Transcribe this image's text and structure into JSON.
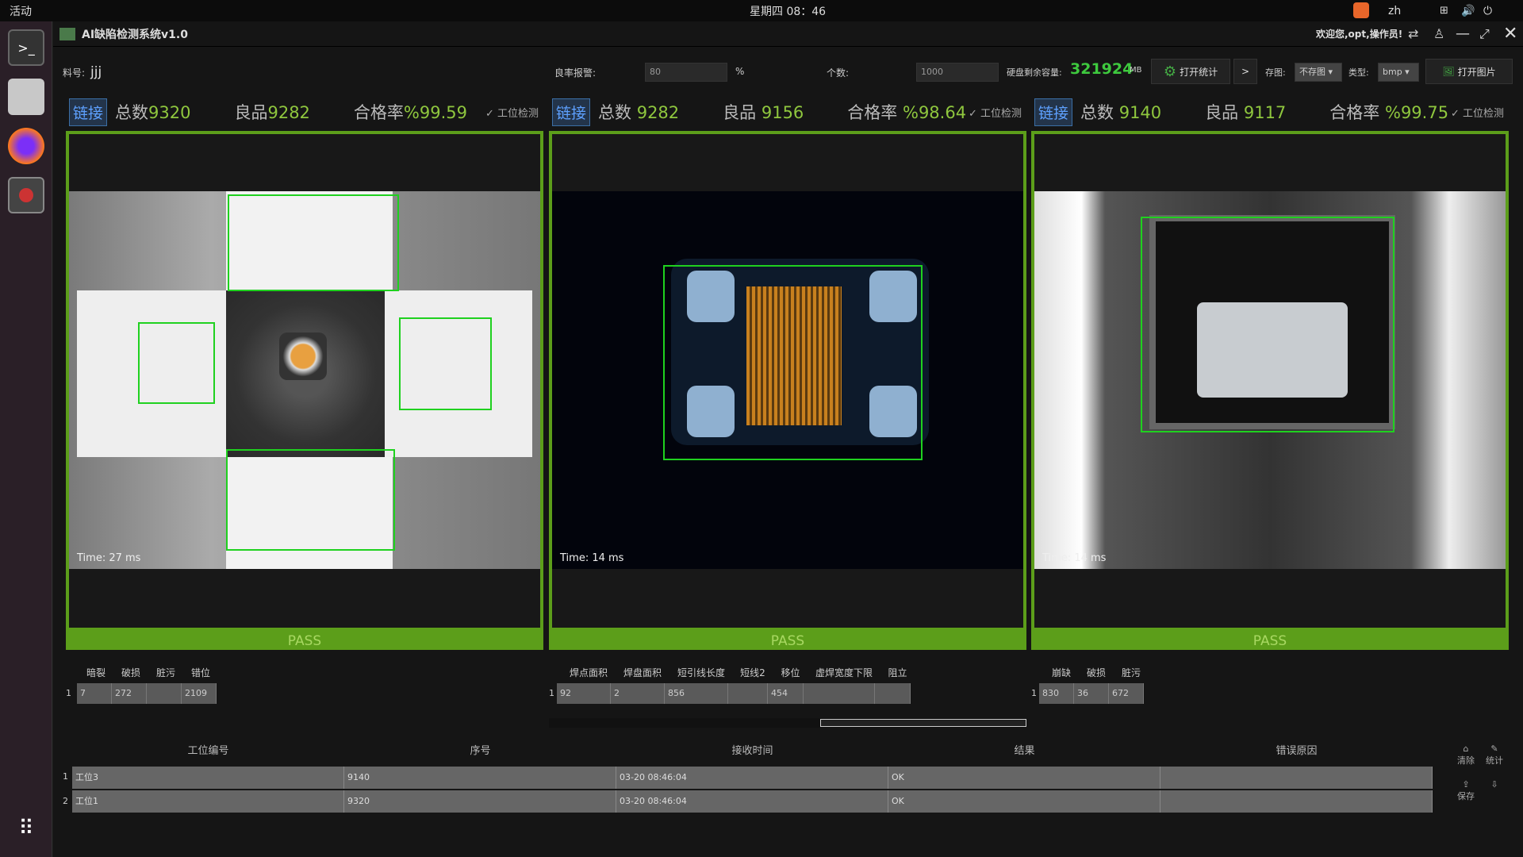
{
  "system": {
    "activities": "活动",
    "clock": "星期四 08：46",
    "lang": "zh"
  },
  "app": {
    "title": "AI缺陷检测系统v1.0",
    "welcome": "欢迎您,opt,操作员!"
  },
  "toolbar": {
    "part_label": "料号:",
    "part_value": "jjj",
    "yield_alarm_label": "良率报警:",
    "yield_alarm_value": "80",
    "percent": "%",
    "count_label": "个数:",
    "count_value": "1000",
    "disk_label": "硬盘剩余容量:",
    "disk_value": "321924",
    "disk_unit": "MB",
    "open_stats": "打开统计",
    "arrow": ">",
    "save_label": "存图:",
    "save_value": "不存图",
    "type_label": "类型:",
    "type_value": "bmp",
    "open_image": "打开图片"
  },
  "panels": [
    {
      "link": "链接",
      "total_label": "总数",
      "total": "9320",
      "good_label": "良品",
      "good": "9282",
      "rate_label": "合格率",
      "rate": "%99.59",
      "check": "✓ 工位检测",
      "time": "Time:  27  ms",
      "result": "PASS",
      "cols": [
        "暗裂",
        "破损",
        "脏污",
        "错位"
      ],
      "row_index": "1",
      "values": [
        "7",
        "272",
        "",
        "2109"
      ]
    },
    {
      "link": "链接",
      "total_label": "总数",
      "total": "9282",
      "good_label": "良品",
      "good": "9156",
      "rate_label": "合格率",
      "rate": "%98.64",
      "check": "✓ 工位检测",
      "time": "Time:  14  ms",
      "result": "PASS",
      "cols": [
        "焊点面积",
        "焊盘面积",
        "短引线长度",
        "短线2",
        "移位",
        "虚焊宽度下限",
        "阻立"
      ],
      "row_index": "1",
      "values": [
        "92",
        "2",
        "856",
        "",
        "454",
        "",
        ""
      ]
    },
    {
      "link": "链接",
      "total_label": "总数",
      "total": "9140",
      "good_label": "良品",
      "good": "9117",
      "rate_label": "合格率",
      "rate": "%99.75",
      "check": "✓ 工位检测",
      "time": "Time:  14  ms",
      "result": "PASS",
      "cols": [
        "崩缺",
        "破损",
        "脏污"
      ],
      "row_index": "1",
      "values": [
        "830",
        "36",
        "672"
      ]
    }
  ],
  "log": {
    "headers": [
      "工位编号",
      "序号",
      "接收时间",
      "结果",
      "错误原因"
    ],
    "rows": [
      [
        "工位3",
        "9140",
        "03-20 08:46:04",
        "OK",
        ""
      ],
      [
        "工位1",
        "9320",
        "03-20 08:46:04",
        "OK",
        ""
      ]
    ],
    "actions": {
      "clear": "清除",
      "stats": "统计",
      "save": "保存"
    }
  }
}
